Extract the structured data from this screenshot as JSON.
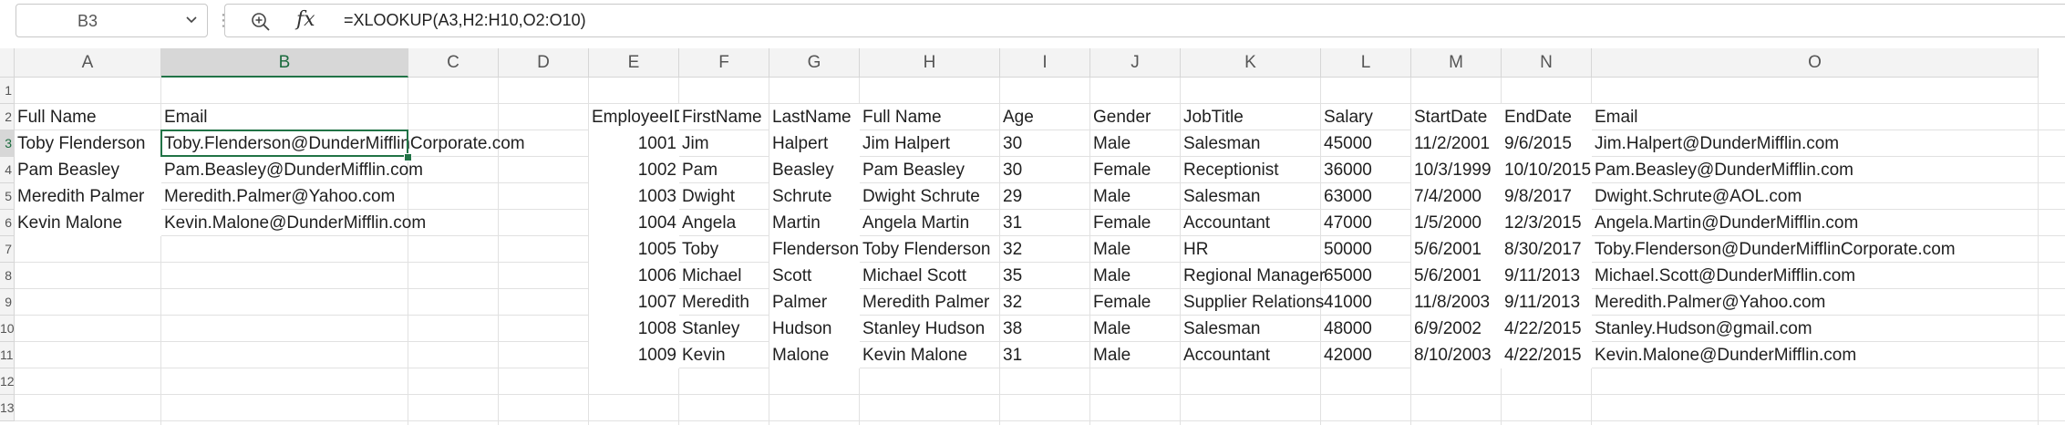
{
  "formula_bar": {
    "name_box": "B3",
    "formula": "=XLOOKUP(A3,H2:H10,O2:O10)"
  },
  "columns": [
    "A",
    "B",
    "C",
    "D",
    "E",
    "F",
    "G",
    "H",
    "I",
    "J",
    "K",
    "L",
    "M",
    "N",
    "O"
  ],
  "row_numbers": [
    "1",
    "2",
    "3",
    "4",
    "5",
    "6",
    "7",
    "8",
    "9",
    "10",
    "11",
    "12",
    "13"
  ],
  "lookup": {
    "headers": [
      "Full Name",
      "Email"
    ],
    "rows": [
      [
        "Toby Flenderson",
        "Toby.Flenderson@DunderMifflinCorporate.com"
      ],
      [
        "Pam Beasley",
        "Pam.Beasley@DunderMifflin.com"
      ],
      [
        "Meredith Palmer",
        "Meredith.Palmer@Yahoo.com"
      ],
      [
        "Kevin Malone",
        "Kevin.Malone@DunderMifflin.com"
      ]
    ]
  },
  "employees": {
    "headers": [
      "EmployeeID",
      "FirstName",
      "LastName",
      "Full Name",
      "Age",
      "Gender",
      "JobTitle",
      "Salary",
      "StartDate",
      "EndDate",
      "Email"
    ],
    "rows": [
      [
        "1001",
        "Jim",
        "Halpert",
        "Jim Halpert",
        "30",
        "Male",
        "Salesman",
        "45000",
        "11/2/2001",
        "9/6/2015",
        "Jim.Halpert@DunderMifflin.com"
      ],
      [
        "1002",
        "Pam",
        "Beasley",
        "Pam Beasley",
        "30",
        "Female",
        "Receptionist",
        "36000",
        "10/3/1999",
        "10/10/2015",
        "Pam.Beasley@DunderMifflin.com"
      ],
      [
        "1003",
        "Dwight",
        "Schrute",
        "Dwight Schrute",
        "29",
        "Male",
        "Salesman",
        "63000",
        "7/4/2000",
        "9/8/2017",
        "Dwight.Schrute@AOL.com"
      ],
      [
        "1004",
        "Angela",
        "Martin",
        "Angela Martin",
        "31",
        "Female",
        "Accountant",
        "47000",
        "1/5/2000",
        "12/3/2015",
        "Angela.Martin@DunderMifflin.com"
      ],
      [
        "1005",
        "Toby",
        "Flenderson",
        "Toby Flenderson",
        "32",
        "Male",
        "HR",
        "50000",
        "5/6/2001",
        "8/30/2017",
        "Toby.Flenderson@DunderMifflinCorporate.com"
      ],
      [
        "1006",
        "Michael",
        "Scott",
        "Michael Scott",
        "35",
        "Male",
        "Regional Manager",
        "65000",
        "5/6/2001",
        "9/11/2013",
        "Michael.Scott@DunderMifflin.com"
      ],
      [
        "1007",
        "Meredith",
        "Palmer",
        "Meredith Palmer",
        "32",
        "Female",
        "Supplier Relations",
        "41000",
        "11/8/2003",
        "9/11/2013",
        "Meredith.Palmer@Yahoo.com"
      ],
      [
        "1008",
        "Stanley",
        "Hudson",
        "Stanley Hudson",
        "38",
        "Male",
        "Salesman",
        "48000",
        "6/9/2002",
        "4/22/2015",
        "Stanley.Hudson@gmail.com"
      ],
      [
        "1009",
        "Kevin",
        "Malone",
        "Kevin Malone",
        "31",
        "Male",
        "Accountant",
        "42000",
        "8/10/2003",
        "4/22/2015",
        "Kevin.Malone@DunderMifflin.com"
      ]
    ]
  },
  "selected_cell": {
    "column": "B",
    "row": "3"
  },
  "colors": {
    "accent": "#217346"
  }
}
